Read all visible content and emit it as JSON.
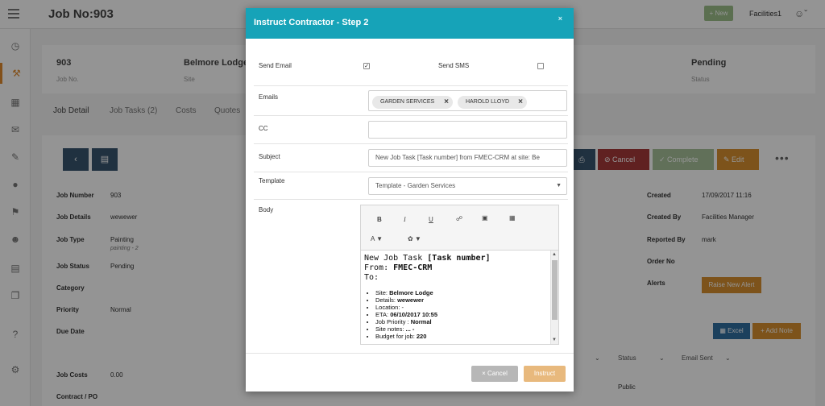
{
  "header": {
    "job_title": "Job No:903",
    "new_button": "+ New",
    "user_name": "Facilities1"
  },
  "summary": [
    {
      "value": "903",
      "label": "Job No."
    },
    {
      "value": "Belmore Lodge",
      "label": "Site"
    },
    {
      "value": "Pending",
      "label": "Status"
    }
  ],
  "tabs": [
    "Job Detail",
    "Job Tasks (2)",
    "Costs",
    "Quotes"
  ],
  "actions": {
    "cancel": "Cancel",
    "complete": "Complete",
    "edit": "Edit"
  },
  "details_left": [
    {
      "label": "Job Number",
      "value": "903"
    },
    {
      "label": "Job Details",
      "value": "wewewer"
    },
    {
      "label": "Job Type",
      "value": "Painting",
      "sub": "painting - 2"
    },
    {
      "label": "Job Status",
      "value": "Pending"
    },
    {
      "label": "Category",
      "value": ""
    },
    {
      "label": "Priority",
      "value": "Normal"
    },
    {
      "label": "Due Date",
      "value": ""
    }
  ],
  "details_right": [
    {
      "label": "Created",
      "value": "17/09/2017 11:16"
    },
    {
      "label": "Created By",
      "value": "Facilities Manager"
    },
    {
      "label": "Reported By",
      "value": "mark"
    },
    {
      "label": "Order No",
      "value": ""
    },
    {
      "label": "Alerts",
      "value": ""
    }
  ],
  "raise_alert": "Raise New Alert",
  "excel": "Excel",
  "add_note": "+ Add Note",
  "costs": {
    "label": "Job Costs",
    "value": "0.00",
    "contract_label": "Contract / PO"
  },
  "notes_table": {
    "status": "Status",
    "email_sent": "Email Sent",
    "public": "Public"
  },
  "modal": {
    "title": "Instruct Contractor - Step 2",
    "send_email": "Send Email",
    "send_sms": "Send SMS",
    "emails_label": "Emails",
    "emails": [
      "GARDEN SERVICES",
      "HAROLD LLOYD"
    ],
    "cc_label": "CC",
    "subject_label": "Subject",
    "subject_value": "New Job Task [Task number] from FMEC-CRM at site: Be",
    "template_label": "Template",
    "template_value": "Template - Garden Services",
    "body_label": "Body",
    "body": {
      "line1_prefix": "New Job Task ",
      "line1_bold": "[Task number]",
      "line2_prefix": "From: ",
      "line2_bold": "FMEC-CRM",
      "line3": "To:",
      "items": [
        {
          "k": "Site: ",
          "v": "Belmore Lodge"
        },
        {
          "k": "Details: ",
          "v": "wewewer"
        },
        {
          "k": "Location: -",
          "v": ""
        },
        {
          "k": "ETA: ",
          "v": "06/10/2017 10:55"
        },
        {
          "k": "Job Priority : ",
          "v": "Normal"
        },
        {
          "k": "Site notes: ",
          "v": "... -"
        },
        {
          "k": "Budget for job: ",
          "v": "220"
        }
      ]
    },
    "cancel_label": "Cancel",
    "instruct_label": "Instruct"
  }
}
